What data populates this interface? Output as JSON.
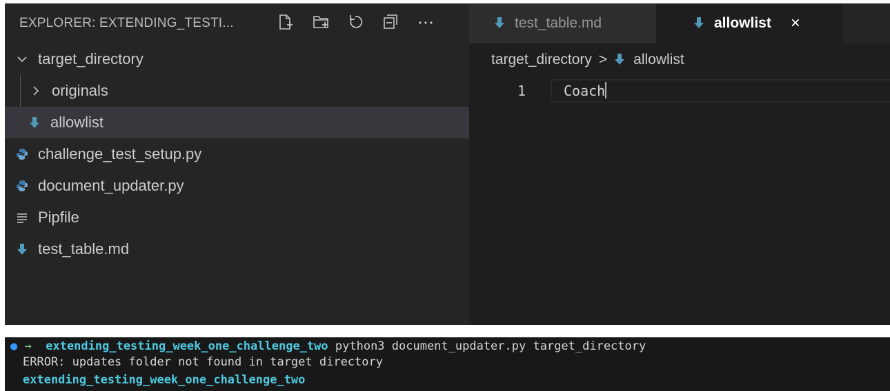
{
  "explorer": {
    "title": "EXPLORER: EXTENDING_TESTI...",
    "actions": [
      {
        "name": "new-file-icon"
      },
      {
        "name": "new-folder-icon"
      },
      {
        "name": "refresh-icon"
      },
      {
        "name": "collapse-all-icon"
      },
      {
        "name": "more-actions-icon"
      }
    ],
    "tree": [
      {
        "label": "target_directory",
        "icon": "chevron-down-icon"
      },
      {
        "label": "originals",
        "icon": "chevron-right-icon"
      },
      {
        "label": "allowlist",
        "icon": "markdown-arrow-icon"
      },
      {
        "label": "challenge_test_setup.py",
        "icon": "python-icon"
      },
      {
        "label": "document_updater.py",
        "icon": "python-icon"
      },
      {
        "label": "Pipfile",
        "icon": "lines-icon"
      },
      {
        "label": "test_table.md",
        "icon": "markdown-arrow-icon"
      }
    ]
  },
  "editor": {
    "tabs": [
      {
        "label": "test_table.md",
        "icon": "markdown-arrow-icon"
      },
      {
        "label": "allowlist",
        "icon": "markdown-arrow-icon",
        "active": true,
        "close": "×"
      }
    ],
    "breadcrumb": {
      "folder": "target_directory",
      "separator": ">",
      "file": "allowlist"
    },
    "lines": [
      {
        "number": "1",
        "text": "Coach"
      }
    ]
  },
  "terminal": {
    "dot": "●",
    "arrow": "→",
    "prompt_dir": "extending_testing_week_one_challenge_two",
    "command": "python3 document_updater.py target_directory",
    "error": "ERROR: updates folder not found in target directory",
    "prompt_dir_2": "extending_testing_week_one_challenge_two"
  },
  "colors": {
    "markdown_icon": "#519aba",
    "python_icon": "#3c78aa",
    "terminal_dir": "#4ec9e0",
    "terminal_arrow": "#89d185",
    "terminal_dot": "#3794ff"
  }
}
